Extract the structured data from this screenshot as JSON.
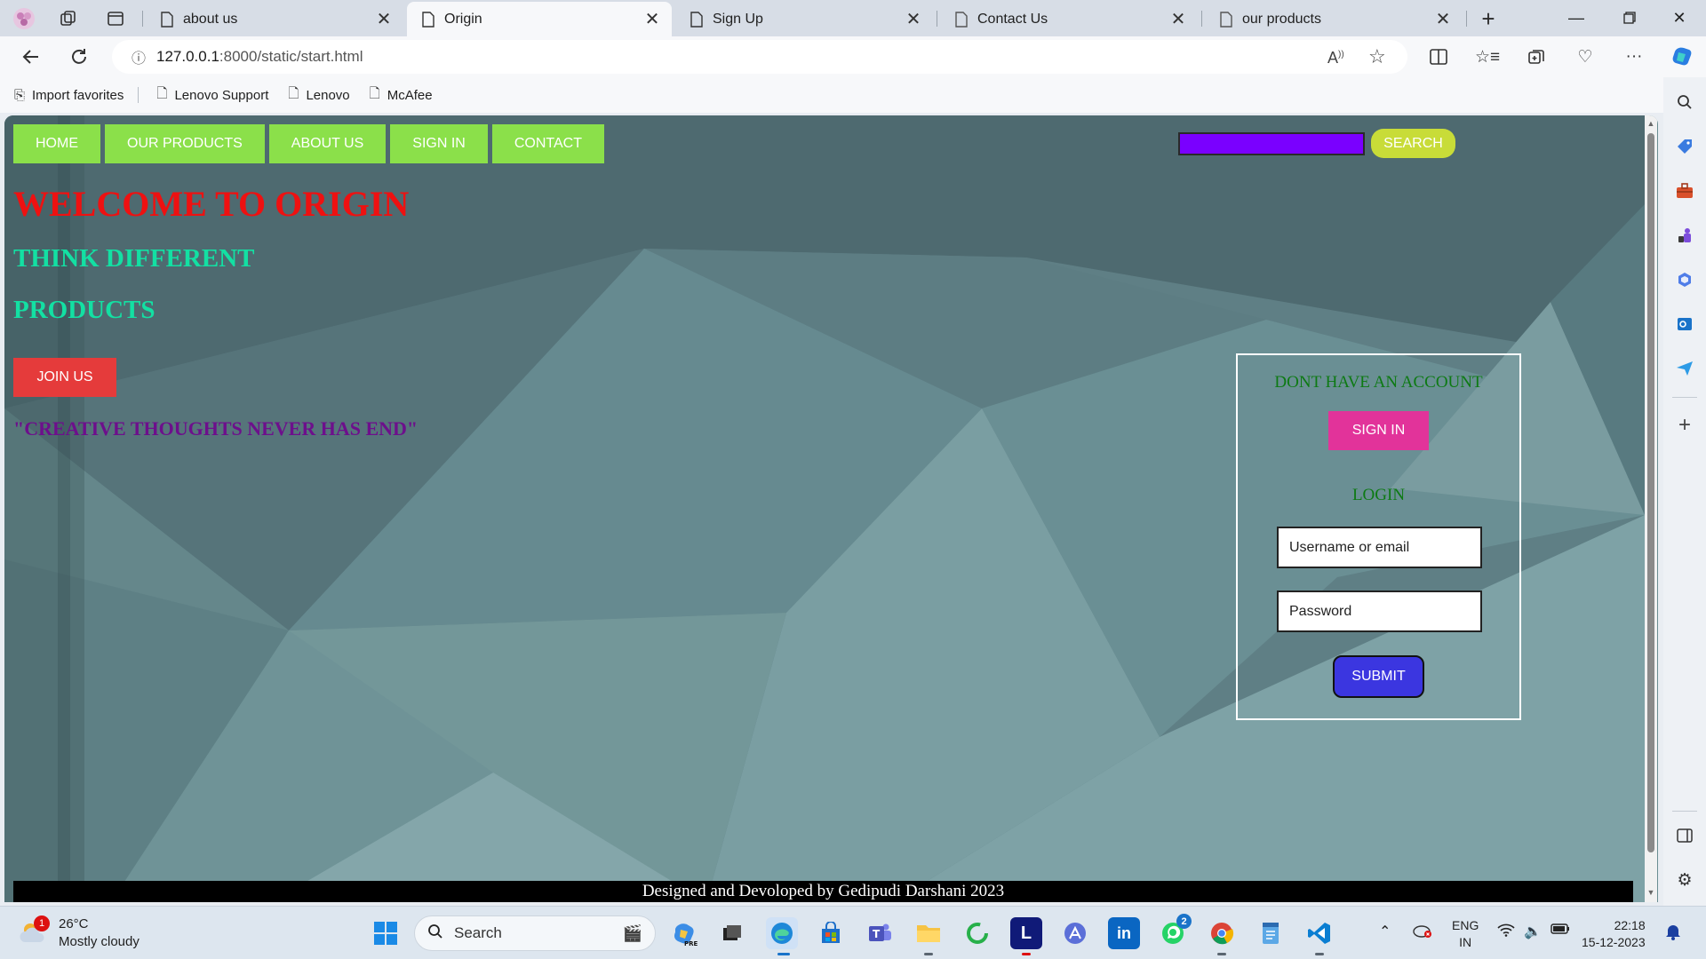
{
  "browser": {
    "tabs": [
      {
        "title": "about us",
        "active": false
      },
      {
        "title": "Origin",
        "active": true
      },
      {
        "title": "Sign Up",
        "active": false
      },
      {
        "title": "Contact Us",
        "active": false
      },
      {
        "title": "our products",
        "active": false
      }
    ],
    "url_host": "127.0.0.1",
    "url_path": ":8000/static/start.html",
    "favorites": [
      "Import favorites",
      "Lenovo Support",
      "Lenovo",
      "McAfee"
    ]
  },
  "page": {
    "nav": [
      "HOME",
      "OUR PRODUCTS",
      "ABOUT US",
      "SIGN IN",
      "CONTACT"
    ],
    "search_value": "",
    "search_button": "SEARCH",
    "welcome": "WELCOME TO ORIGIN",
    "think": "THINK DIFFERENT",
    "products": "PRODUCTS",
    "join_button": "JOIN US",
    "quote": "\"CREATIVE THOUGHTS NEVER HAS END\"",
    "panel": {
      "no_account": "DONT HAVE AN ACCOUNT",
      "signin_button": "SIGN IN",
      "login_heading": "LOGIN",
      "username_placeholder": "Username or email",
      "password_placeholder": "Password",
      "submit_button": "SUBMIT"
    },
    "footer": "Designed and Devoloped by Gedipudi Darshani 2023"
  },
  "taskbar": {
    "weather_temp": "26°C",
    "weather_desc": "Mostly cloudy",
    "weather_badge": "1",
    "search_label": "Search",
    "whatsapp_badge": "2",
    "lang_top": "ENG",
    "lang_bottom": "IN",
    "time": "22:18",
    "date": "15-12-2023"
  },
  "colors": {
    "nav_green": "#8be04a",
    "welcome_red": "#ee1111",
    "heading_teal": "#13e0a3",
    "quote_purple": "#6d0f8c",
    "search_purple": "#7a00ff",
    "search_button": "#c8dc38",
    "signin_pink": "#e2339a",
    "submit_blue": "#3b36e0",
    "panel_text_green": "#0d7a13"
  }
}
